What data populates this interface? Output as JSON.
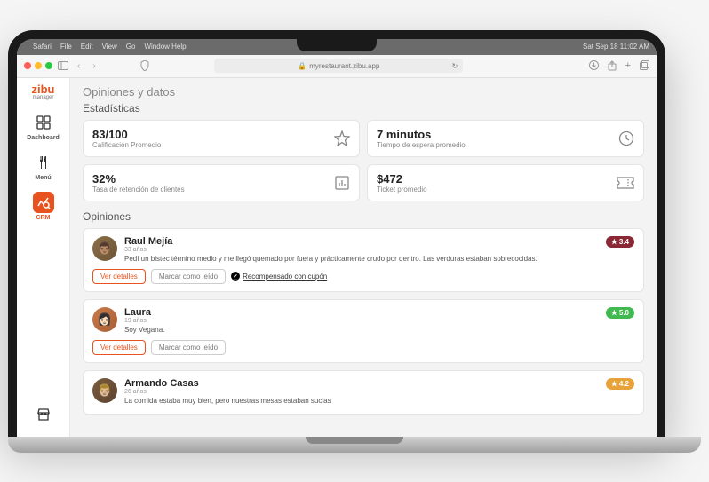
{
  "menubar": {
    "items": [
      "Safari",
      "File",
      "Edit",
      "View",
      "Go",
      "Window Help"
    ],
    "clock": "Sat Sep 18  11:02 AM"
  },
  "browser": {
    "url": "myrestaurant.zibu.app"
  },
  "brand": {
    "name": "zibu",
    "sub": "manager"
  },
  "nav": {
    "items": [
      {
        "label": "Dashboard"
      },
      {
        "label": "Menú"
      },
      {
        "label": "CRM"
      }
    ]
  },
  "page": {
    "title": "Opiniones y datos",
    "stats_title": "Estadísticas",
    "reviews_title": "Opiniones"
  },
  "stats": [
    {
      "value": "83/100",
      "label": "Calificación Promedio"
    },
    {
      "value": "7 minutos",
      "label": "Tiempo de espera promedio"
    },
    {
      "value": "32%",
      "label": "Tasa de retención de clientes"
    },
    {
      "value": "$472",
      "label": "Ticket promedio"
    }
  ],
  "buttons": {
    "details": "Ver detalles",
    "mark_read": "Marcar como leído",
    "reward": "Recompensado con cupón"
  },
  "reviews": [
    {
      "name": "Raul Mejía",
      "age": "33 años",
      "text": "Pedí un bistec término medio y me llegó quemado por fuera y prácticamente crudo por dentro. Las verduras estaban sobrecocidas.",
      "rating": "3.4",
      "rewarded": true
    },
    {
      "name": "Laura",
      "age": "19 años",
      "text": "Soy Vegana.",
      "rating": "5.0",
      "rewarded": false
    },
    {
      "name": "Armando Casas",
      "age": "26 años",
      "text": "La comida estaba muy bien, pero nuestras mesas estaban sucias",
      "rating": "4.2",
      "rewarded": false
    }
  ]
}
